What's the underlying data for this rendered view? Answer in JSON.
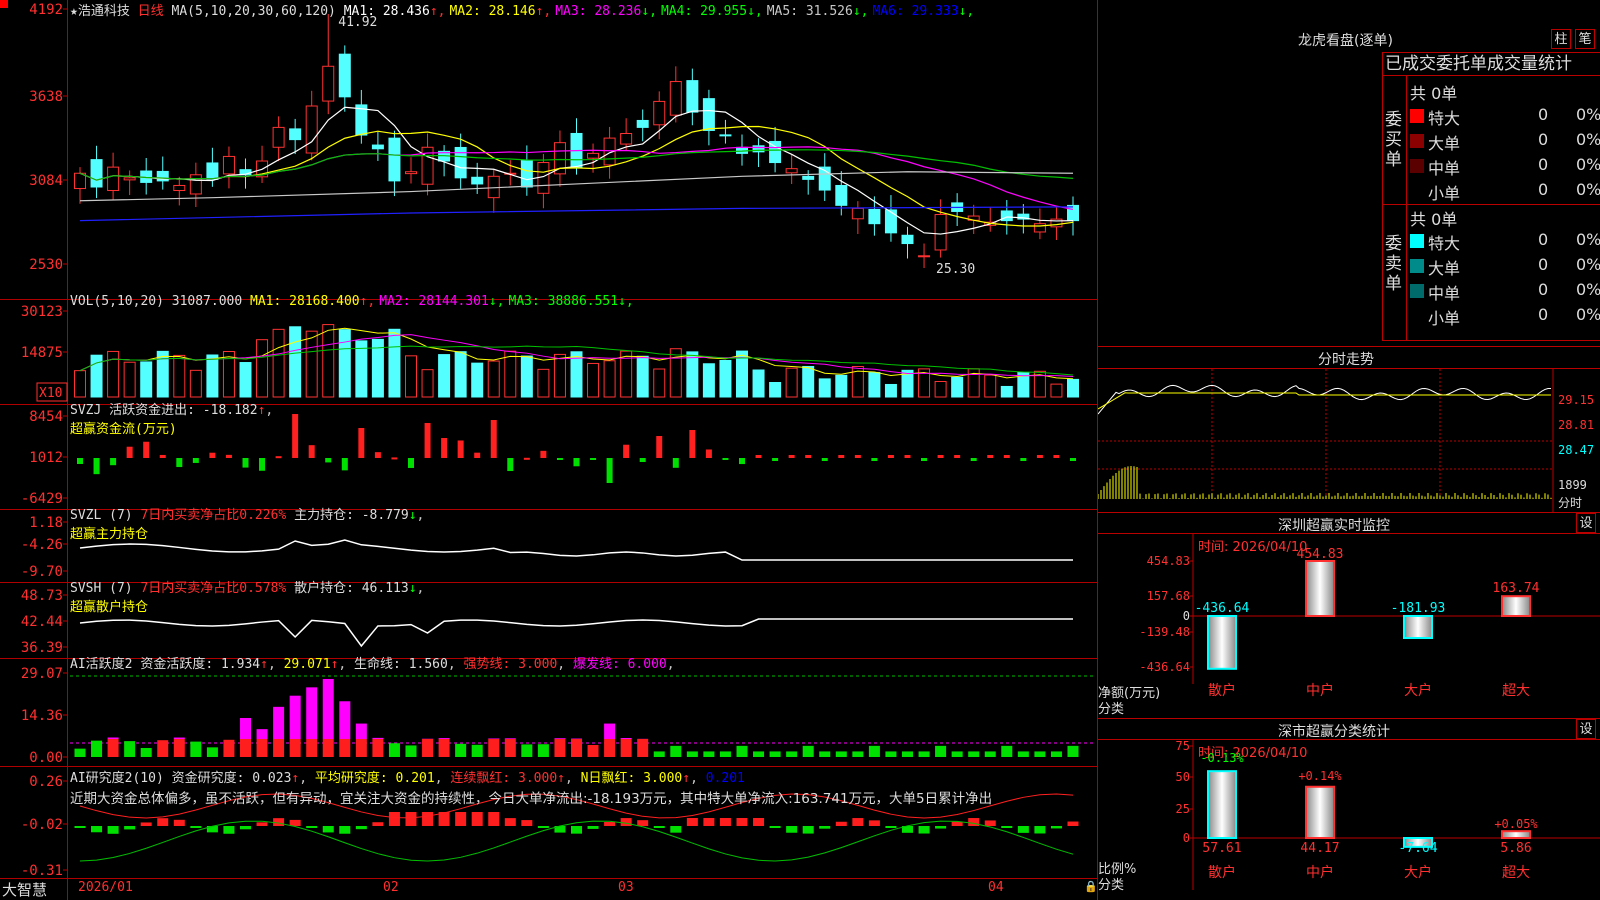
{
  "stock": {
    "name": "浩通科技",
    "period_label": "日线",
    "star": "★"
  },
  "header": {
    "kline_ma_label": "MA(5,10,20,30,60,120)",
    "ma": [
      {
        "name": "MA1",
        "value": "28.436",
        "arrow": "↑",
        "color": "#ffffff"
      },
      {
        "name": "MA2",
        "value": "28.146",
        "arrow": "↑",
        "color": "#ffff00"
      },
      {
        "name": "MA3",
        "value": "28.236",
        "arrow": "↓",
        "color": "#ff00ff"
      },
      {
        "name": "MA4",
        "value": "29.955",
        "arrow": "↓",
        "color": "#00ff00"
      },
      {
        "name": "MA5",
        "value": "31.526",
        "arrow": "↓",
        "color": "#c8c8c8"
      },
      {
        "name": "MA6",
        "value": "29.333",
        "arrow": "↓",
        "color": "#0000ff"
      }
    ],
    "vol_label": "VOL(5,10,20)",
    "vol_value": "31087.000",
    "vol_ma": [
      {
        "name": "MA1",
        "value": "28168.400",
        "arrow": "↑",
        "color": "#ffff00"
      },
      {
        "name": "MA2",
        "value": "28144.301",
        "arrow": "↓",
        "color": "#ff00ff"
      },
      {
        "name": "MA3",
        "value": "38886.551",
        "arrow": "↓",
        "color": "#00ff00"
      }
    ],
    "svzj_label": "SVZJ",
    "svzj_name": "活跃资金进出:",
    "svzj_value": "-18.182",
    "svzj_sub": "超赢资金流(万元)",
    "svzl_label": "SVZL (7)",
    "svzl_ratio": "7日内买卖净占比0.226%",
    "svzl_name": "主力持仓:",
    "svzl_value": "-8.779",
    "svzl_sub": "超赢主力持仓",
    "svsh_label": "SVSH (7)",
    "svsh_ratio": "7日内买卖净占比0.578%",
    "svsh_name": "散户持仓:",
    "svsh_value": "46.113",
    "svsh_sub": "超赢散户持仓",
    "ai1_label": "AI活跃度2",
    "ai1_name": "资金活跃度:",
    "ai1_value": "1.934",
    "ai1_b": "29.071",
    "ai1_c_name": "生命线:",
    "ai1_c": "1.560",
    "ai1_d": "强势线: 3.000",
    "ai1_e": "爆发线: 6.000",
    "ai2_label": "AI研究度2(10)",
    "ai2_name": "资金研究度:",
    "ai2_value": "0.023",
    "ai2_avg": "平均研究度: 0.201",
    "ai2_lx": "连续飘红: 3.000",
    "ai2_nr": "N日飘红: 3.000",
    "ai2_last": "0.201",
    "comment": "近期大资金总体偏多，虽不活跃，但有异动，宜关注大资金的持续性，今日大单净流出:-18.193万元，其中特大单净流入:163.741万元，大单5日累计净出"
  },
  "axes": {
    "kline": [
      "4192",
      "3638",
      "3084",
      "2530"
    ],
    "vol": [
      "30123",
      "14875"
    ],
    "vol_unit": "X10",
    "svzj": [
      "8454",
      "1012",
      "-6429"
    ],
    "svzl": [
      "1.18",
      "-4.26",
      "-9.70"
    ],
    "svsh": [
      "48.73",
      "42.44",
      "36.39"
    ],
    "ai1": [
      "29.07",
      "14.36",
      "0.00"
    ],
    "ai2": [
      "0.26",
      "-0.02",
      "-0.31"
    ],
    "dates": [
      "2026/01",
      "02",
      "03",
      "04"
    ],
    "brand": "大智慧",
    "hi_label": "41.92",
    "lo_label": "25.30"
  },
  "longhu": {
    "title": "龙虎看盘(逐单)",
    "btn1": "柱",
    "btn2": "笔",
    "subtitle": "已成交委托单成交量统计",
    "buy_label": "委买单",
    "sell_label": "委卖单",
    "buy_total": "共 0单",
    "sell_total": "共 0单",
    "buy_rows": [
      {
        "name": "特大",
        "count": "0",
        "pct": "0%",
        "color": "#ff0000"
      },
      {
        "name": "大单",
        "count": "0",
        "pct": "0%",
        "color": "#8b0000"
      },
      {
        "name": "中单",
        "count": "0",
        "pct": "0%",
        "color": "#5a0000"
      },
      {
        "name": "小单",
        "count": "0",
        "pct": "0%",
        "color": "#000000"
      }
    ],
    "sell_rows": [
      {
        "name": "特大",
        "count": "0",
        "pct": "0%",
        "color": "#00ffff"
      },
      {
        "name": "大单",
        "count": "0",
        "pct": "0%",
        "color": "#008b8b"
      },
      {
        "name": "中单",
        "count": "0",
        "pct": "0%",
        "color": "#006b6b"
      },
      {
        "name": "小单",
        "count": "0",
        "pct": "0%",
        "color": "#000000"
      }
    ]
  },
  "minute": {
    "title": "分时走势",
    "prices": [
      "29.15",
      "28.81",
      "28.47"
    ],
    "vol": "1899",
    "vol_unit": "分时"
  },
  "monitor": {
    "title": "深圳超赢实时监控",
    "settings": "设",
    "time": "时间: 2026/04/10",
    "unit1": "净额(万元)",
    "unit2": "分类",
    "yticks": [
      "454.83",
      "157.68",
      "0",
      "-139.48",
      "-436.64"
    ],
    "categories": [
      "散户",
      "中户",
      "大户",
      "超大"
    ],
    "values": [
      -436.64,
      454.83,
      -181.93,
      163.74
    ],
    "value_labels": [
      "-436.64",
      "454.83",
      "-181.93",
      "163.74"
    ]
  },
  "classify": {
    "title": "深市超赢分类统计",
    "settings": "设",
    "time": "时间: 2026/04/10",
    "unit1": "比例%",
    "unit2": "分类",
    "yticks": [
      "75",
      "50",
      "25",
      "0"
    ],
    "categories": [
      "散户",
      "中户",
      "大户",
      "超大"
    ],
    "values": [
      57.61,
      44.17,
      -7.64,
      5.86
    ],
    "value_labels": [
      "57.61",
      "44.17",
      "-7.64",
      "5.86"
    ],
    "change_labels": [
      "-0.13%",
      "+0.14%",
      "",
      "+0.05%"
    ]
  },
  "chart_data": {
    "type": "candlestick",
    "title": "浩通科技 日线",
    "x": [
      "2026/01",
      "02",
      "03",
      "04"
    ],
    "ylim": [
      25.3,
      41.92
    ],
    "ma": {
      "MA1": 28.436,
      "MA2": 28.146,
      "MA3": 28.236,
      "MA4": 29.955,
      "MA5": 31.526,
      "MA6": 29.333
    },
    "volume": {
      "current": 31087.0,
      "MA1": 28168.4,
      "MA2": 28144.301,
      "MA3": 38886.551
    },
    "high": 41.92,
    "low": 25.3
  }
}
